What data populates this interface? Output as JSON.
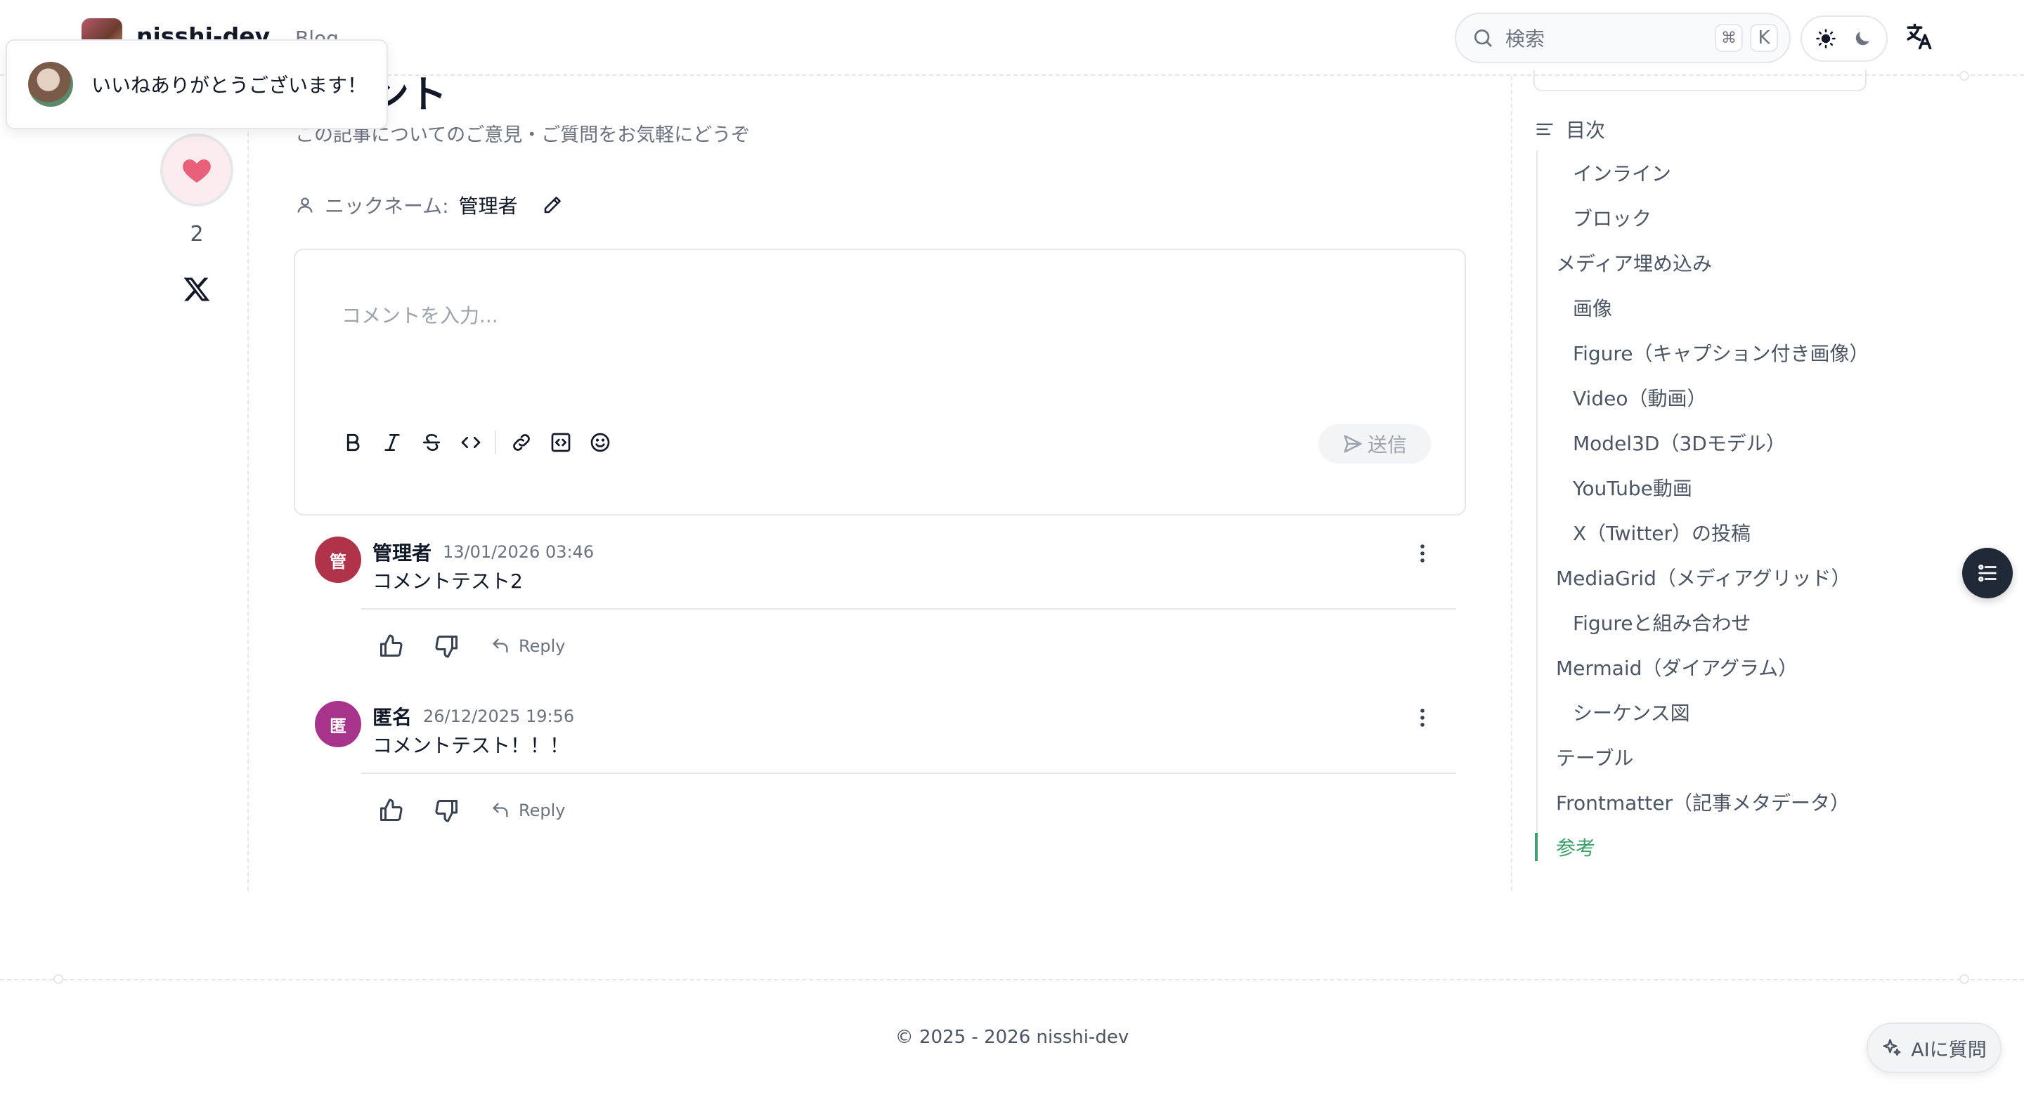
{
  "header": {
    "brand_name": "nisshi-dev",
    "nav_blog": "Blog",
    "search_placeholder": "検索",
    "search_kbd_mod": "⌘",
    "search_kbd_key": "K"
  },
  "toast": {
    "message": "いいねありがとうございます！"
  },
  "rail": {
    "like_count": "2"
  },
  "comments_section": {
    "title": "コメント",
    "subtitle": "この記事についてのご意見・ご質問をお気軽にどうぞ",
    "nickname_label": "ニックネーム:",
    "nickname_value": "管理者",
    "editor_placeholder": "コメントを入力...",
    "send_label": "送信",
    "comments": [
      {
        "avatar_char": "管",
        "avatar_color": "#b0334a",
        "author": "管理者",
        "date": "13/01/2026 03:46",
        "body": "コメントテスト2",
        "reply_label": "Reply"
      },
      {
        "avatar_char": "匿",
        "avatar_color": "#a8338a",
        "author": "匿名",
        "date": "26/12/2025 19:56",
        "body": "コメントテスト！！！",
        "reply_label": "Reply"
      }
    ]
  },
  "toc": {
    "title": "目次",
    "items": [
      {
        "label": "インライン",
        "level": 2
      },
      {
        "label": "ブロック",
        "level": 2
      },
      {
        "label": "メディア埋め込み",
        "level": 1
      },
      {
        "label": "画像",
        "level": 2
      },
      {
        "label": "Figure（キャプション付き画像）",
        "level": 2
      },
      {
        "label": "Video（動画）",
        "level": 2
      },
      {
        "label": "Model3D（3Dモデル）",
        "level": 2
      },
      {
        "label": "YouTube動画",
        "level": 2
      },
      {
        "label": "X（Twitter）の投稿",
        "level": 2
      },
      {
        "label": "MediaGrid（メディアグリッド）",
        "level": 1
      },
      {
        "label": "Figureと組み合わせ",
        "level": 2
      },
      {
        "label": "Mermaid（ダイアグラム）",
        "level": 1
      },
      {
        "label": "シーケンス図",
        "level": 2
      },
      {
        "label": "テーブル",
        "level": 1
      },
      {
        "label": "Frontmatter（記事メタデータ）",
        "level": 1
      },
      {
        "label": "参考",
        "level": 1,
        "active": true
      }
    ]
  },
  "footer": {
    "copyright": "© 2025 - 2026 nisshi-dev",
    "ai_button": "AIに質問"
  },
  "colors": {
    "accent": "#3f9f6b",
    "like": "#e8607a"
  }
}
